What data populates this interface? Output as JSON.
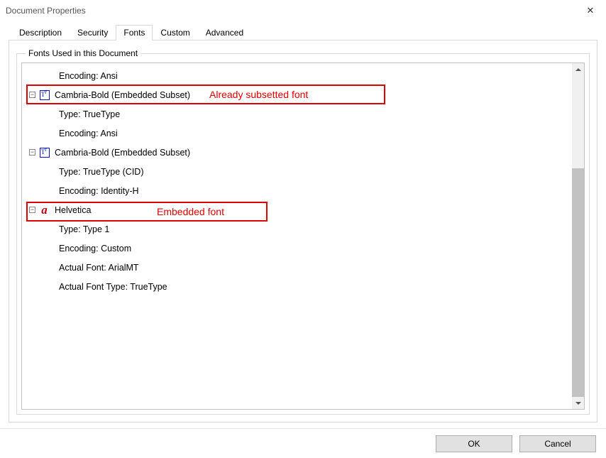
{
  "window": {
    "title": "Document Properties"
  },
  "tabs": {
    "t0": "Description",
    "t1": "Security",
    "t2": "Fonts",
    "t3": "Custom",
    "t4": "Advanced",
    "active_index": 2
  },
  "groupbox": {
    "label": "Fonts Used in this Document"
  },
  "tree": {
    "row0": "Encoding: Ansi",
    "font1": {
      "name": "Cambria-Bold (Embedded Subset)",
      "type": "Type: TrueType",
      "encoding": "Encoding: Ansi",
      "icon": "truetype-icon"
    },
    "font2": {
      "name": "Cambria-Bold (Embedded Subset)",
      "type": "Type: TrueType (CID)",
      "encoding": "Encoding: Identity-H",
      "icon": "truetype-icon"
    },
    "font3": {
      "name": "Helvetica",
      "type": "Type: Type 1",
      "encoding": "Encoding: Custom",
      "actual_font": "Actual Font: ArialMT",
      "actual_type": "Actual Font Type: TrueType",
      "icon": "type1-icon"
    }
  },
  "annotations": {
    "a1": "Already subsetted font",
    "a2": "Embedded font"
  },
  "buttons": {
    "ok": "OK",
    "cancel": "Cancel"
  },
  "expander_glyph": "⊟",
  "close_glyph": "✕"
}
